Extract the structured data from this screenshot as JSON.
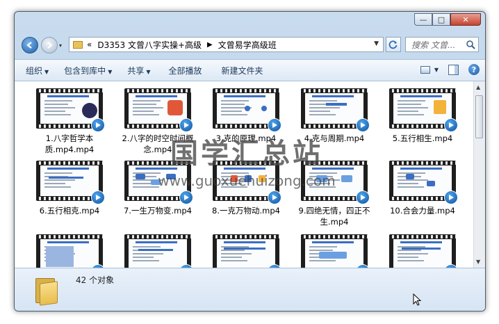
{
  "window": {
    "caption_buttons": {
      "minimize": "—",
      "maximize": "□",
      "close": "✕"
    }
  },
  "address_bar": {
    "history_glyph": "▾",
    "overflow": "«",
    "crumbs": [
      "D3353 文曾八字实操+高级",
      "文曾易学高级班"
    ],
    "separator": "▶",
    "dropdown": "▼"
  },
  "search": {
    "placeholder": "搜索 文曾..."
  },
  "toolbar": {
    "organize": "组织",
    "include_in_library": "包含到库中",
    "share": "共享",
    "play_all": "全部播放",
    "new_folder": "新建文件夹",
    "dropdown_arrow": "▼"
  },
  "files": [
    {
      "label": "1.八字哲学本质.mp4.mp4"
    },
    {
      "label": "2.八字的时空时间概念.mp4"
    },
    {
      "label": "3.克的原理.mp4"
    },
    {
      "label": "4.克与周期.mp4"
    },
    {
      "label": "5.五行相生.mp4"
    },
    {
      "label": "6.五行相克.mp4"
    },
    {
      "label": "7.一生万物变.mp4"
    },
    {
      "label": "8.一克万物动.mp4"
    },
    {
      "label": "9.四绝无情，四正不生.mp4"
    },
    {
      "label": "10.合会力量.mp4"
    },
    {
      "label": ""
    },
    {
      "label": ""
    },
    {
      "label": ""
    },
    {
      "label": ""
    },
    {
      "label": ""
    }
  ],
  "watermark": {
    "line1": "国学汇总站",
    "line2": "www.guoxuehuizong.com"
  },
  "status": {
    "object_count": "42 个对象"
  },
  "colors": {
    "accent": "#1b5ea8",
    "window_frame": "#b5cde6",
    "details_pane": "#dce8f5"
  }
}
